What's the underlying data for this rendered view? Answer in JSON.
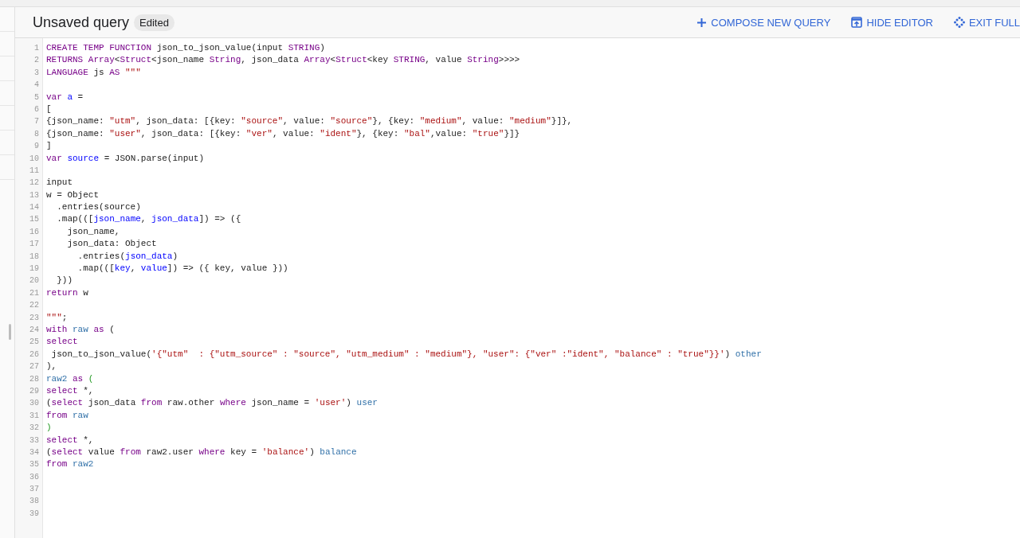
{
  "header": {
    "title": "Unsaved query",
    "badge": "Edited"
  },
  "actions": [
    {
      "kind": "compose",
      "label": "COMPOSE NEW QUERY"
    },
    {
      "kind": "hide",
      "label": "HIDE EDITOR"
    },
    {
      "kind": "exit",
      "label": "EXIT FULL"
    }
  ],
  "editor": {
    "lines": [
      {
        "number": "1",
        "tokens": [
          {
            "kind": "keyword",
            "text": "CREATE TEMP FUNCTION"
          },
          {
            "kind": "plain",
            "text": " json_to_json_value(input "
          },
          {
            "kind": "keyword",
            "text": "STRING"
          },
          {
            "kind": "plain",
            "text": ")"
          }
        ]
      },
      {
        "number": "2",
        "tokens": [
          {
            "kind": "keyword",
            "text": "RETURNS Array"
          },
          {
            "kind": "plain",
            "text": "<"
          },
          {
            "kind": "keyword",
            "text": "Struct"
          },
          {
            "kind": "plain",
            "text": "<json_name "
          },
          {
            "kind": "keyword",
            "text": "String"
          },
          {
            "kind": "plain",
            "text": ", json_data "
          },
          {
            "kind": "keyword",
            "text": "Array"
          },
          {
            "kind": "plain",
            "text": "<"
          },
          {
            "kind": "keyword",
            "text": "Struct"
          },
          {
            "kind": "plain",
            "text": "<key "
          },
          {
            "kind": "keyword",
            "text": "STRING"
          },
          {
            "kind": "plain",
            "text": ", value "
          },
          {
            "kind": "keyword",
            "text": "String"
          },
          {
            "kind": "plain",
            "text": ">>>>"
          }
        ]
      },
      {
        "number": "3",
        "tokens": [
          {
            "kind": "keyword",
            "text": "LANGUAGE"
          },
          {
            "kind": "plain",
            "text": " js "
          },
          {
            "kind": "keyword",
            "text": "AS"
          },
          {
            "kind": "string",
            "text": " \"\"\""
          }
        ]
      },
      {
        "number": "4"
      },
      {
        "number": "5",
        "tokens": [
          {
            "kind": "keyword",
            "text": "var"
          },
          {
            "kind": "variable",
            "text": " a"
          },
          {
            "kind": "plain",
            "text": " ="
          }
        ]
      },
      {
        "number": "6",
        "tokens": [
          {
            "kind": "plain",
            "text": "["
          }
        ]
      },
      {
        "number": "7",
        "tokens": [
          {
            "kind": "plain",
            "text": "{json_name: "
          },
          {
            "kind": "string",
            "text": "\"utm\""
          },
          {
            "kind": "plain",
            "text": ", json_data: [{key: "
          },
          {
            "kind": "string",
            "text": "\"source\""
          },
          {
            "kind": "plain",
            "text": ", value: "
          },
          {
            "kind": "string",
            "text": "\"source\""
          },
          {
            "kind": "plain",
            "text": "}, {key: "
          },
          {
            "kind": "string",
            "text": "\"medium\""
          },
          {
            "kind": "plain",
            "text": ", value: "
          },
          {
            "kind": "string",
            "text": "\"medium\""
          },
          {
            "kind": "plain",
            "text": "}]},"
          }
        ]
      },
      {
        "number": "8",
        "tokens": [
          {
            "kind": "plain",
            "text": "{json_name: "
          },
          {
            "kind": "string",
            "text": "\"user\""
          },
          {
            "kind": "plain",
            "text": ", json_data: [{key: "
          },
          {
            "kind": "string",
            "text": "\"ver\""
          },
          {
            "kind": "plain",
            "text": ", value: "
          },
          {
            "kind": "string",
            "text": "\"ident\""
          },
          {
            "kind": "plain",
            "text": "}, {key: "
          },
          {
            "kind": "string",
            "text": "\"bal\""
          },
          {
            "kind": "plain",
            "text": ",value: "
          },
          {
            "kind": "string",
            "text": "\"true\""
          },
          {
            "kind": "plain",
            "text": "}]}"
          }
        ]
      },
      {
        "number": "9",
        "tokens": [
          {
            "kind": "plain",
            "text": "]"
          }
        ]
      },
      {
        "number": "10",
        "tokens": [
          {
            "kind": "keyword",
            "text": "var"
          },
          {
            "kind": "variable",
            "text": " source"
          },
          {
            "kind": "plain",
            "text": " = JSON.parse(input)"
          }
        ]
      },
      {
        "number": "11"
      },
      {
        "number": "12",
        "tokens": [
          {
            "kind": "plain",
            "text": "input"
          }
        ]
      },
      {
        "number": "13",
        "tokens": [
          {
            "kind": "plain",
            "text": "w = Object"
          }
        ]
      },
      {
        "number": "14",
        "tokens": [
          {
            "kind": "plain",
            "text": "  .entries(source)"
          }
        ]
      },
      {
        "number": "15",
        "tokens": [
          {
            "kind": "plain",
            "text": "  .map((["
          },
          {
            "kind": "variable",
            "text": "json_name"
          },
          {
            "kind": "plain",
            "text": ", "
          },
          {
            "kind": "variable",
            "text": "json_data"
          },
          {
            "kind": "plain",
            "text": "]) => ({"
          }
        ]
      },
      {
        "number": "16",
        "tokens": [
          {
            "kind": "plain",
            "text": "    json_name,"
          }
        ]
      },
      {
        "number": "17",
        "tokens": [
          {
            "kind": "plain",
            "text": "    json_data: Object"
          }
        ]
      },
      {
        "number": "18",
        "tokens": [
          {
            "kind": "plain",
            "text": "      .entries("
          },
          {
            "kind": "variable",
            "text": "json_data"
          },
          {
            "kind": "plain",
            "text": ")"
          }
        ]
      },
      {
        "number": "19",
        "tokens": [
          {
            "kind": "plain",
            "text": "      .map((["
          },
          {
            "kind": "variable",
            "text": "key"
          },
          {
            "kind": "plain",
            "text": ", "
          },
          {
            "kind": "variable",
            "text": "value"
          },
          {
            "kind": "plain",
            "text": "]) => ({ key, value }))"
          }
        ]
      },
      {
        "number": "20",
        "tokens": [
          {
            "kind": "plain",
            "text": "  }))"
          }
        ]
      },
      {
        "number": "21",
        "tokens": [
          {
            "kind": "keyword",
            "text": "return"
          },
          {
            "kind": "plain",
            "text": " w"
          }
        ]
      },
      {
        "number": "22"
      },
      {
        "number": "23",
        "tokens": [
          {
            "kind": "string",
            "text": "\"\"\""
          },
          {
            "kind": "plain",
            "text": ";"
          }
        ]
      },
      {
        "number": "24",
        "tokens": [
          {
            "kind": "keyword",
            "text": "with"
          },
          {
            "kind": "definition",
            "text": " raw"
          },
          {
            "kind": "keyword",
            "text": " as"
          },
          {
            "kind": "plain",
            "text": " ("
          }
        ]
      },
      {
        "number": "25",
        "tokens": [
          {
            "kind": "keyword",
            "text": "select"
          }
        ]
      },
      {
        "number": "26",
        "tokens": [
          {
            "kind": "plain",
            "text": " json_to_json_value("
          },
          {
            "kind": "string",
            "text": "'{\"utm\"  : {\"utm_source\" : \"source\", \"utm_medium\" : \"medium\"}, \"user\": {\"ver\" :\"ident\", \"balance\" : \"true\"}}'"
          },
          {
            "kind": "plain",
            "text": ") "
          },
          {
            "kind": "definition",
            "text": "other"
          }
        ]
      },
      {
        "number": "27",
        "tokens": [
          {
            "kind": "plain",
            "text": "),"
          }
        ]
      },
      {
        "number": "28",
        "tokens": [
          {
            "kind": "definition",
            "text": "raw2"
          },
          {
            "kind": "keyword",
            "text": " as"
          },
          {
            "kind": "bracket",
            "text": " ("
          }
        ]
      },
      {
        "number": "29",
        "tokens": [
          {
            "kind": "keyword",
            "text": "select"
          },
          {
            "kind": "plain",
            "text": " *,"
          }
        ]
      },
      {
        "number": "30",
        "tokens": [
          {
            "kind": "plain",
            "text": "("
          },
          {
            "kind": "keyword",
            "text": "select"
          },
          {
            "kind": "plain",
            "text": " json_data "
          },
          {
            "kind": "keyword",
            "text": "from"
          },
          {
            "kind": "plain",
            "text": " raw.other "
          },
          {
            "kind": "keyword",
            "text": "where"
          },
          {
            "kind": "plain",
            "text": " json_name = "
          },
          {
            "kind": "string",
            "text": "'user'"
          },
          {
            "kind": "plain",
            "text": ") "
          },
          {
            "kind": "definition",
            "text": "user"
          }
        ]
      },
      {
        "number": "31",
        "tokens": [
          {
            "kind": "keyword",
            "text": "from"
          },
          {
            "kind": "definition",
            "text": " raw"
          }
        ]
      },
      {
        "number": "32",
        "tokens": [
          {
            "kind": "bracket",
            "text": ")"
          }
        ]
      },
      {
        "number": "33",
        "tokens": [
          {
            "kind": "keyword",
            "text": "select"
          },
          {
            "kind": "plain",
            "text": " *,"
          }
        ]
      },
      {
        "number": "34",
        "tokens": [
          {
            "kind": "plain",
            "text": "("
          },
          {
            "kind": "keyword",
            "text": "select"
          },
          {
            "kind": "plain",
            "text": " value "
          },
          {
            "kind": "keyword",
            "text": "from"
          },
          {
            "kind": "plain",
            "text": " raw2.user "
          },
          {
            "kind": "keyword",
            "text": "where"
          },
          {
            "kind": "plain",
            "text": " key = "
          },
          {
            "kind": "string",
            "text": "'balance'"
          },
          {
            "kind": "plain",
            "text": ") "
          },
          {
            "kind": "definition",
            "text": "balance"
          }
        ]
      },
      {
        "number": "35",
        "tokens": [
          {
            "kind": "keyword",
            "text": "from"
          },
          {
            "kind": "definition",
            "text": " raw2"
          }
        ]
      },
      {
        "number": "36"
      },
      {
        "number": "37"
      },
      {
        "number": "38"
      },
      {
        "number": "39"
      }
    ]
  }
}
